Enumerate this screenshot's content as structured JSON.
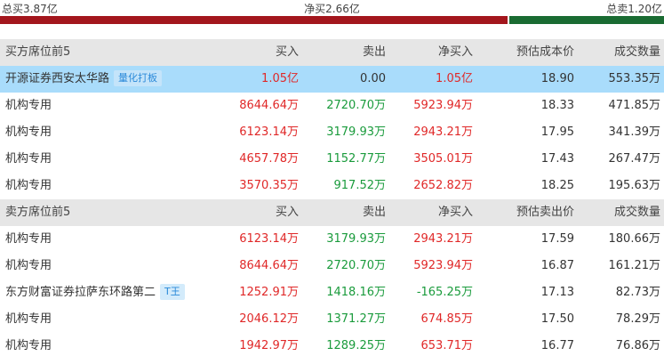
{
  "summary": {
    "total_buy": "总买3.87亿",
    "net_buy": "净买2.66亿",
    "total_sell": "总卖1.20亿",
    "colors": {
      "buy": "#a3161d",
      "sell": "#1a6b32"
    }
  },
  "buy_section": {
    "headers": [
      "买方席位前5",
      "买入",
      "卖出",
      "净买入",
      "预估成本价",
      "成交数量"
    ],
    "rows": [
      {
        "name": "开源证券西安太华路",
        "tag": "量化打板",
        "buy": "1.05亿",
        "sell": "0.00",
        "net": "1.05亿",
        "price": "18.90",
        "volume": "553.35万"
      },
      {
        "name": "机构专用",
        "tag": "",
        "buy": "8644.64万",
        "sell": "2720.70万",
        "net": "5923.94万",
        "price": "18.33",
        "volume": "471.85万"
      },
      {
        "name": "机构专用",
        "tag": "",
        "buy": "6123.14万",
        "sell": "3179.93万",
        "net": "2943.21万",
        "price": "17.95",
        "volume": "341.39万"
      },
      {
        "name": "机构专用",
        "tag": "",
        "buy": "4657.78万",
        "sell": "1152.77万",
        "net": "3505.01万",
        "price": "17.43",
        "volume": "267.47万"
      },
      {
        "name": "机构专用",
        "tag": "",
        "buy": "3570.35万",
        "sell": "917.52万",
        "net": "2652.82万",
        "price": "18.25",
        "volume": "195.63万"
      }
    ]
  },
  "sell_section": {
    "headers": [
      "卖方席位前5",
      "买入",
      "卖出",
      "净买入",
      "预估卖出价",
      "成交数量"
    ],
    "rows": [
      {
        "name": "机构专用",
        "tag": "",
        "buy": "6123.14万",
        "sell": "3179.93万",
        "net": "2943.21万",
        "price": "17.59",
        "volume": "180.66万"
      },
      {
        "name": "机构专用",
        "tag": "",
        "buy": "8644.64万",
        "sell": "2720.70万",
        "net": "5923.94万",
        "price": "16.87",
        "volume": "161.21万"
      },
      {
        "name": "东方财富证券拉萨东环路第二",
        "tag": "T王",
        "buy": "1252.91万",
        "sell": "1418.16万",
        "net": "-165.25万",
        "price": "17.13",
        "volume": "82.73万"
      },
      {
        "name": "机构专用",
        "tag": "",
        "buy": "2046.12万",
        "sell": "1371.27万",
        "net": "674.85万",
        "price": "17.50",
        "volume": "78.29万"
      },
      {
        "name": "机构专用",
        "tag": "",
        "buy": "1942.97万",
        "sell": "1289.25万",
        "net": "653.71万",
        "price": "16.77",
        "volume": "76.86万"
      }
    ]
  }
}
